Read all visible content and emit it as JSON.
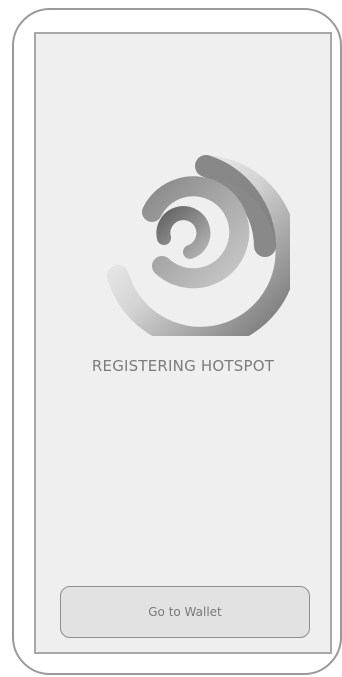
{
  "status": {
    "label": "REGISTERING HOTSPOT"
  },
  "actions": {
    "wallet_button_label": "Go to Wallet"
  },
  "icons": {
    "progress": "swirl-spinner-icon"
  },
  "colors": {
    "screen_background": "#efefef",
    "frame_border": "#9a9a9a",
    "text": "#7c7c7c",
    "button_background": "#e2e2e2"
  }
}
